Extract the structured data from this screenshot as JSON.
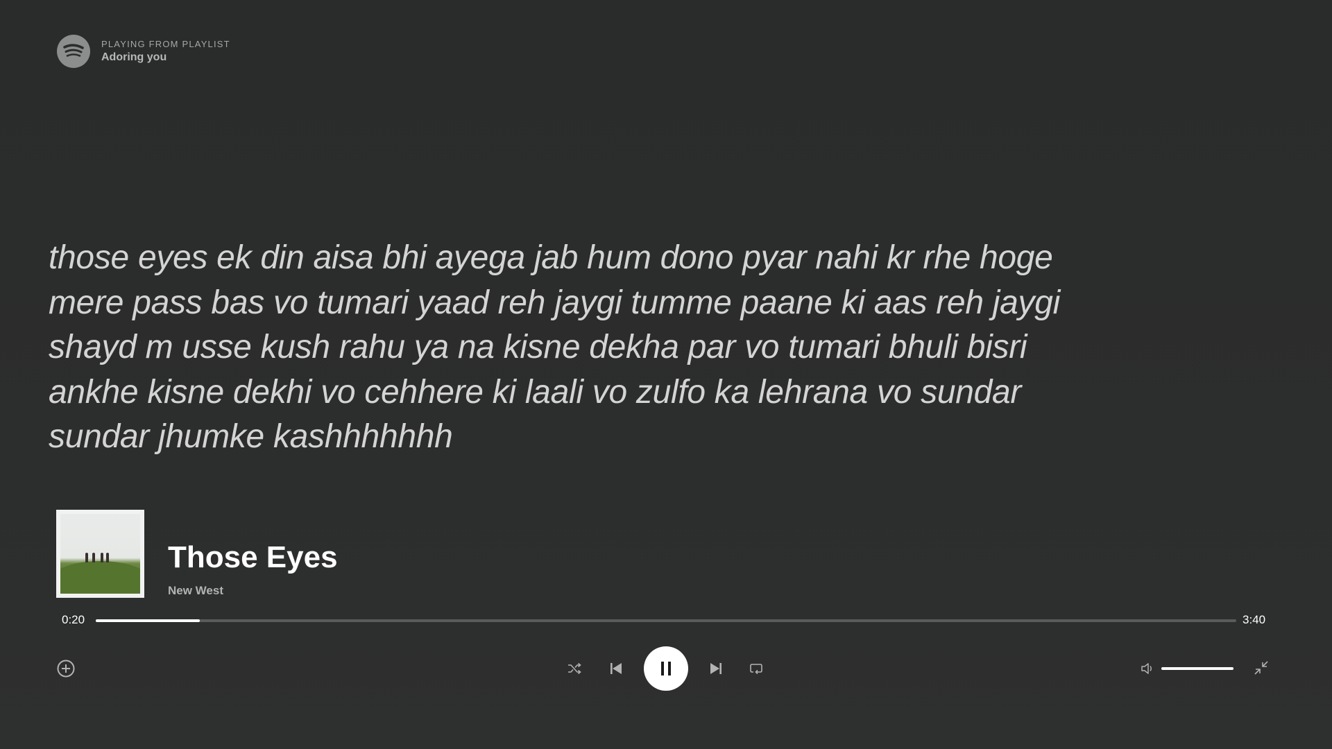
{
  "header": {
    "context_label": "PLAYING FROM PLAYLIST",
    "playlist_name": "Adoring you"
  },
  "lyrics": {
    "text": "those eyes ek din aisa bhi ayega jab hum dono pyar nahi kr rhe hoge mere pass bas vo tumari yaad reh jaygi tumme paane ki aas reh jaygi shayd m usse kush rahu ya na kisne dekha par vo tumari bhuli bisri ankhe kisne dekhi vo cehhere ki laali vo zulfo ka lehrana vo sundar sundar jhumke kashhhhhhh"
  },
  "now_playing": {
    "title": "Those Eyes",
    "artist": "New West",
    "elapsed": "0:20",
    "duration": "3:40",
    "progress_fraction": 0.091,
    "volume_fraction": 1.0
  },
  "icons": {
    "logo": "spotify-logo-icon",
    "add": "add-circle-icon",
    "shuffle": "shuffle-icon",
    "previous": "skip-previous-icon",
    "play_pause": "pause-icon",
    "next": "skip-next-icon",
    "repeat": "repeat-icon",
    "volume": "volume-icon",
    "minimize": "exit-fullscreen-icon"
  },
  "colors": {
    "background": "#2b2c2c",
    "accent": "#ffffff",
    "muted_text": "#b3b3b3"
  }
}
